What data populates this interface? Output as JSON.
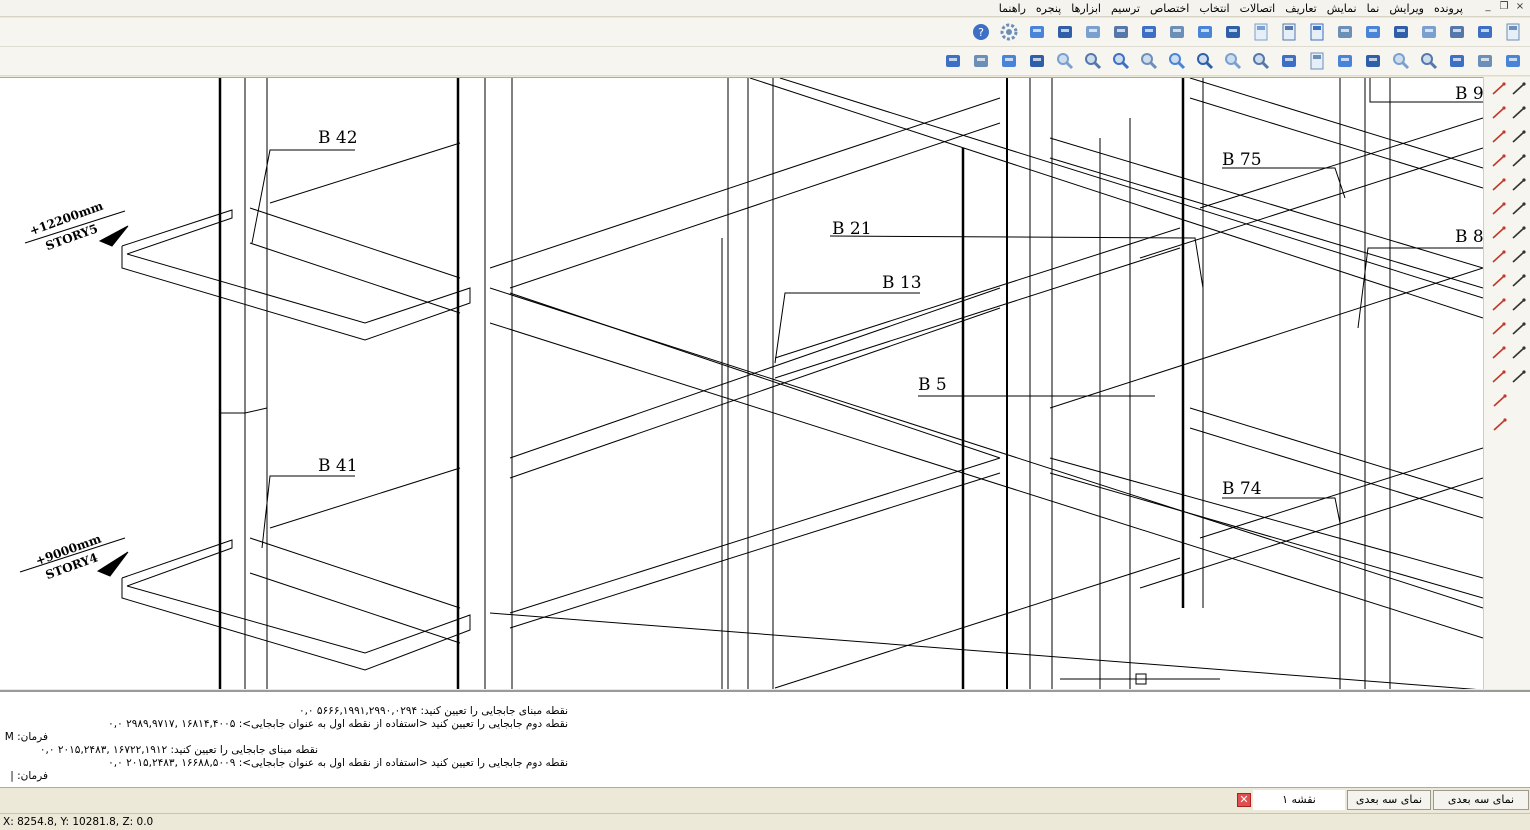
{
  "menu": {
    "items": [
      "پرونده",
      "ویرایش",
      "نما",
      "نمایش",
      "تعاریف",
      "اتصالات",
      "انتخاب",
      "اختصاص",
      "ترسیم",
      "ابزارها",
      "پنجره",
      "راهنما"
    ]
  },
  "window_controls": [
    "_",
    "❐",
    "×"
  ],
  "toolbar1_icons": [
    "help-icon",
    "settings-icon",
    "beam-icon",
    "beam2-icon",
    "column-icon",
    "brace-icon",
    "stair-icon",
    "cube-icon",
    "tool-icon",
    "grid-icon",
    "save-icon",
    "doc-icon",
    "doc2-icon",
    "export-icon",
    "import-icon",
    "print-icon",
    "g-icon",
    "table-icon",
    "bolt-icon",
    "page-icon"
  ],
  "toolbar2_icons": [
    "refresh-icon",
    "window-icon",
    "cylinder-icon",
    "hand-icon",
    "zoom-icon",
    "zoom-in-icon",
    "zoom-window-icon",
    "zoom-out-icon",
    "zoom-all-icon",
    "zoom-prev-icon",
    "zoom-extents-icon",
    "zoom-page-icon",
    "layers-icon",
    "save-disk-icon",
    "pen-icon",
    "check-icon",
    "back-icon",
    "forward-icon",
    "plan-icon",
    "elevation-icon",
    "iso-icon"
  ],
  "drawing": {
    "beam_labels": [
      "B 42",
      "B 41",
      "B 21",
      "B 13",
      "B 5",
      "B 75",
      "B 74",
      "B 9",
      "B 8"
    ],
    "story_labels": [
      {
        "level": "+12200mm",
        "name": "STORY5"
      },
      {
        "level": "+9000mm",
        "name": "STORY4"
      }
    ]
  },
  "command_window": {
    "lines": [
      "نقطه مبنای جابجایی را تعیین کنید:  ۵۶۶۶,۱۹۹۱,۲۹۹۰,۰۲۹۴  ۰,۰",
      "نقطه دوم جابجایی را تعیین کنید <استفاده از نقطه اول به عنوان جابجایی>:  ۱۶۸۱۴,۴۰۰۵ ,۲۹۸۹,۹۷۱۷  ۰,۰",
      "فرمان:  M",
      "نقطه مبنای جابجایی را تعیین کنید:  ۱۶۷۲۲,۱۹۱۲ ,۲۰۱۵,۲۴۸۳  ۰,۰",
      "نقطه دوم جابجایی را تعیین کنید <استفاده از نقطه اول به عنوان جابجایی>:  ۱۶۶۸۸,۵۰۰۹ ,۲۰۱۵,۲۴۸۳  ۰,۰",
      "فرمان:  |"
    ]
  },
  "tabs": {
    "drawing_tab": "نقشه ۱",
    "view_tab_1": "نمای سه بعدی",
    "view_tab_2": "نمای سه بعدی",
    "close_glyph": "✕"
  },
  "status": {
    "coords": "X: 8254.8, Y: 10281.8, Z: 0.0"
  }
}
